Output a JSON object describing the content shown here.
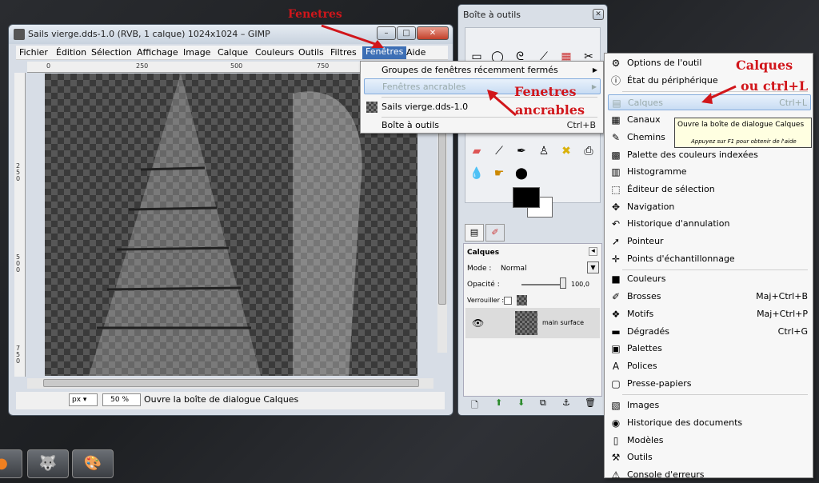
{
  "image_window": {
    "title": "Sails vierge.dds-1.0 (RVB, 1 calque) 1024x1024 – GIMP",
    "menus": [
      "Fichier",
      "Édition",
      "Sélection",
      "Affichage",
      "Image",
      "Calque",
      "Couleurs",
      "Outils",
      "Filtres",
      "Fenêtres",
      "Aide"
    ],
    "ruler_h": [
      "0",
      "250",
      "500",
      "750"
    ],
    "ruler_v": [
      "2",
      "5",
      "0",
      "5",
      "0",
      "0",
      "7",
      "5",
      "0"
    ],
    "status": {
      "unit": "px",
      "zoom": "50 %",
      "message": "Ouvre la boîte de dialogue Calques"
    }
  },
  "fenetres_menu": {
    "items": [
      {
        "label": "Groupes de fenêtres récemment fermés",
        "shortcut": "",
        "submenu": true
      },
      {
        "label": "Fenêtres ancrables",
        "shortcut": "",
        "submenu": true
      },
      {
        "label": "Sails vierge.dds-1.0",
        "shortcut": "",
        "submenu": false
      },
      {
        "label": "Boîte à outils",
        "shortcut": "Ctrl+B",
        "submenu": false
      }
    ]
  },
  "toolbox": {
    "title": "Boîte à outils",
    "layers_panel": {
      "title": "Calques",
      "mode_label": "Mode :",
      "mode_value": "Normal",
      "opacity_label": "Opacité :",
      "opacity_value": "100,0",
      "lock_label": "Verrouiller :",
      "layer_name": "main surface"
    }
  },
  "dockable_menu": {
    "items": [
      {
        "label": "Options de l'outil",
        "shortcut": "",
        "icon": "tool-options-icon",
        "glyph": "⚙"
      },
      {
        "label": "État du périphérique",
        "shortcut": "",
        "icon": "device-status-icon",
        "glyph": "ⓘ"
      },
      {
        "label": "Calques",
        "shortcut": "Ctrl+L",
        "icon": "layers-icon",
        "glyph": "▤"
      },
      {
        "label": "Canaux",
        "shortcut": "",
        "icon": "channels-icon",
        "glyph": "▦"
      },
      {
        "label": "Chemins",
        "shortcut": "",
        "icon": "paths-icon",
        "glyph": "✎"
      },
      {
        "label": "Palette des couleurs indexées",
        "shortcut": "",
        "icon": "colormap-icon",
        "glyph": "▩"
      },
      {
        "label": "Histogramme",
        "shortcut": "",
        "icon": "histogram-icon",
        "glyph": "▥"
      },
      {
        "label": "Éditeur de sélection",
        "shortcut": "",
        "icon": "selection-editor-icon",
        "glyph": "⬚"
      },
      {
        "label": "Navigation",
        "shortcut": "",
        "icon": "navigation-icon",
        "glyph": "✥"
      },
      {
        "label": "Historique d'annulation",
        "shortcut": "",
        "icon": "undo-history-icon",
        "glyph": "↶"
      },
      {
        "label": "Pointeur",
        "shortcut": "",
        "icon": "pointer-icon",
        "glyph": "➚"
      },
      {
        "label": "Points d'échantillonnage",
        "shortcut": "",
        "icon": "sample-points-icon",
        "glyph": "✛"
      },
      {
        "label": "Couleurs",
        "shortcut": "",
        "icon": "colors-icon",
        "glyph": "■"
      },
      {
        "label": "Brosses",
        "shortcut": "Maj+Ctrl+B",
        "icon": "brushes-icon",
        "glyph": "✐"
      },
      {
        "label": "Motifs",
        "shortcut": "Maj+Ctrl+P",
        "icon": "patterns-icon",
        "glyph": "❖"
      },
      {
        "label": "Dégradés",
        "shortcut": "Ctrl+G",
        "icon": "gradients-icon",
        "glyph": "▬"
      },
      {
        "label": "Palettes",
        "shortcut": "",
        "icon": "palettes-icon",
        "glyph": "▣"
      },
      {
        "label": "Polices",
        "shortcut": "",
        "icon": "fonts-icon",
        "glyph": "A"
      },
      {
        "label": "Presse-papiers",
        "shortcut": "",
        "icon": "clipboard-icon",
        "glyph": "▢"
      },
      {
        "label": "Images",
        "shortcut": "",
        "icon": "images-icon",
        "glyph": "▧"
      },
      {
        "label": "Historique des documents",
        "shortcut": "",
        "icon": "document-history-icon",
        "glyph": "◉"
      },
      {
        "label": "Modèles",
        "shortcut": "",
        "icon": "templates-icon",
        "glyph": "▯"
      },
      {
        "label": "Outils",
        "shortcut": "",
        "icon": "tools-icon",
        "glyph": "⚒"
      },
      {
        "label": "Console d'erreurs",
        "shortcut": "",
        "icon": "error-console-icon",
        "glyph": "⚠"
      }
    ]
  },
  "tooltip": {
    "text": "Ouvre la boîte de dialogue Calques",
    "hint": "Appuyez sur F1 pour obtenir de l'aide"
  },
  "annotations": {
    "fenetres": "Fenetres",
    "ancrables_1": "Fenetres",
    "ancrables_2": "ancrables",
    "calques_1": "Calques",
    "calques_2": "ou   ctrl+L"
  },
  "colors": {
    "annotation": "#d1161b",
    "menu_highlight": "#3d6fb5"
  }
}
